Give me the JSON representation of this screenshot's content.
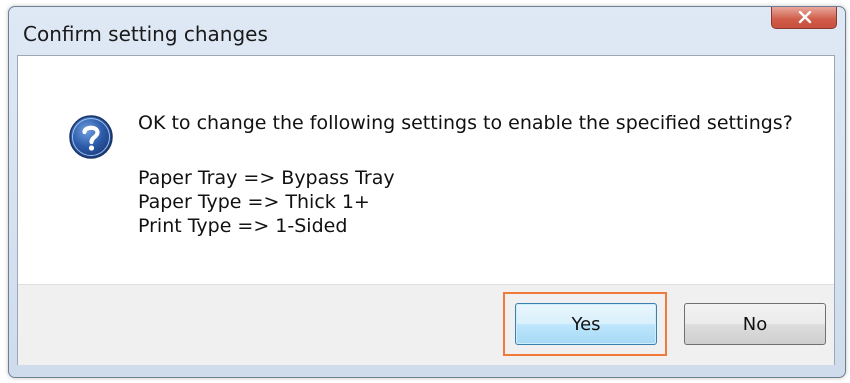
{
  "window": {
    "title": "Confirm setting changes"
  },
  "dialog": {
    "icon": "question-icon",
    "message": "OK to change the following settings to enable the specified settings?",
    "details": [
      "Paper Tray => Bypass Tray",
      "Paper Type => Thick 1+",
      "Print Type => 1-Sided"
    ]
  },
  "buttons": {
    "yes_label": "Yes",
    "no_label": "No"
  },
  "colors": {
    "highlight": "#f07a3c",
    "close_button": "#cf5b48",
    "icon_blue": "#2b5aa8"
  }
}
